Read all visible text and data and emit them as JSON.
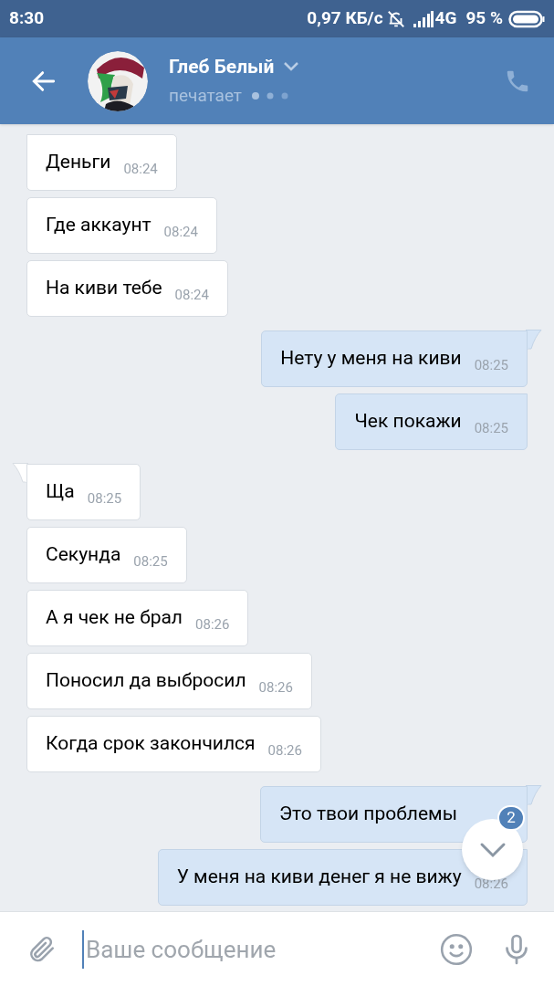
{
  "status_bar": {
    "time": "8:30",
    "speed": "0,97 КБ/с",
    "network": "4G",
    "battery": "95 %"
  },
  "header": {
    "name": "Глеб Белый",
    "status": "печатает"
  },
  "messages": [
    {
      "text": "Деньги",
      "time": "08:24",
      "outgoing": false
    },
    {
      "text": "Где аккаунт",
      "time": "08:24",
      "outgoing": false
    },
    {
      "text": "На киви тебе",
      "time": "08:24",
      "outgoing": false
    },
    {
      "text": "Нету у меня на киви",
      "time": "08:25",
      "outgoing": true
    },
    {
      "text": "Чек покажи",
      "time": "08:25",
      "outgoing": true
    },
    {
      "text": "Ща",
      "time": "08:25",
      "outgoing": false
    },
    {
      "text": "Секунда",
      "time": "08:25",
      "outgoing": false
    },
    {
      "text": "А я чек не брал",
      "time": "08:26",
      "outgoing": false
    },
    {
      "text": "Поносил да выбросил",
      "time": "08:26",
      "outgoing": false
    },
    {
      "text": "Когда срок закончился",
      "time": "08:26",
      "outgoing": false
    },
    {
      "text": "Это твои проблемы",
      "outgoing": true
    },
    {
      "text": "У меня на киви денег я не вижу",
      "time": "08:26",
      "outgoing": true
    }
  ],
  "scroll_button": {
    "badge": "2"
  },
  "composer": {
    "placeholder": "Ваше сообщение"
  }
}
